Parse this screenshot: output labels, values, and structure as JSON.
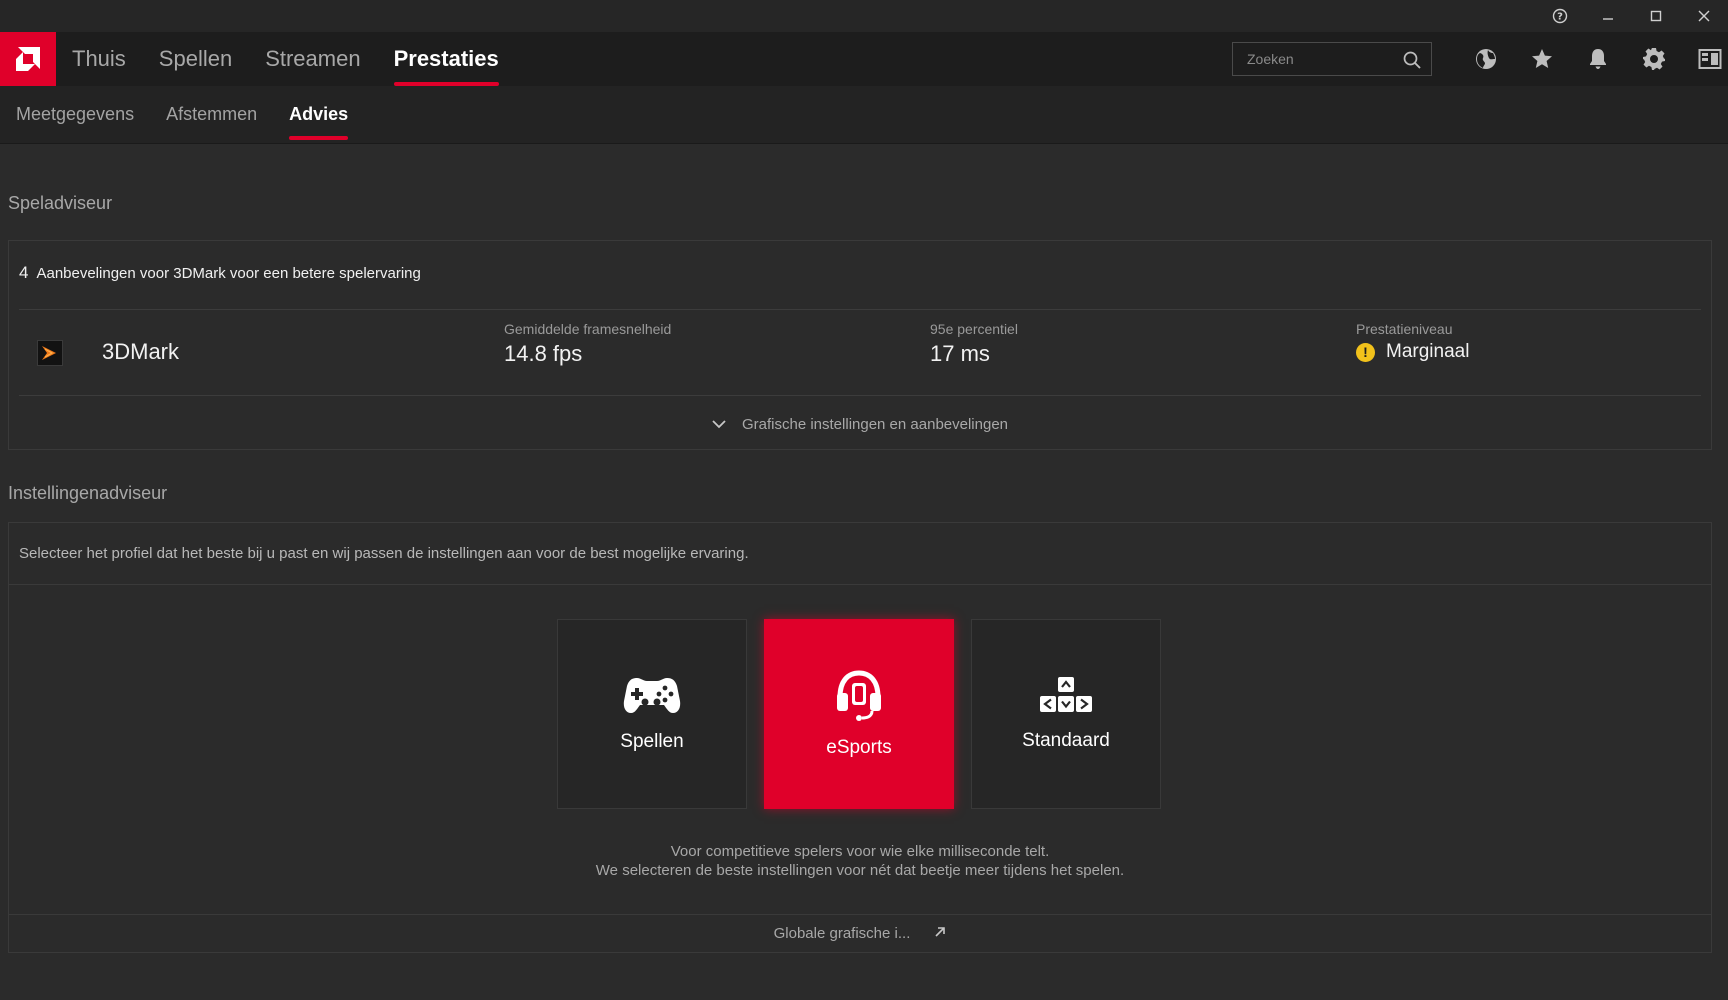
{
  "window": {
    "help_icon": "help-circle-icon",
    "minimize_icon": "minimize-icon",
    "maximize_icon": "maximize-icon",
    "close_icon": "close-icon"
  },
  "brand": {
    "logo": "amd-logo",
    "accent": "#e0002a"
  },
  "main_tabs": [
    {
      "label": "Thuis",
      "active": false
    },
    {
      "label": "Spellen",
      "active": false
    },
    {
      "label": "Streamen",
      "active": false
    },
    {
      "label": "Prestaties",
      "active": true
    }
  ],
  "search": {
    "placeholder": "Zoeken",
    "value": ""
  },
  "toolbar_icons": [
    "globe-icon",
    "star-icon",
    "bell-icon",
    "gear-icon",
    "sidebar-panel-icon"
  ],
  "sub_tabs": [
    {
      "label": "Meetgegevens",
      "active": false
    },
    {
      "label": "Afstemmen",
      "active": false
    },
    {
      "label": "Advies",
      "active": true
    }
  ],
  "game_advisor": {
    "title": "Speladviseur",
    "rec_count": "4",
    "rec_text": "Aanbevelingen voor 3DMark voor een betere spelervaring",
    "game": {
      "name": "3DMark",
      "avg_fps_label": "Gemiddelde framesnelheid",
      "avg_fps_value": "14.8 fps",
      "p95_label": "95e percentiel",
      "p95_value": "17 ms",
      "level_label": "Prestatieniveau",
      "level_value": "Marginaal",
      "level_color": "#f2c21b"
    },
    "expand_label": "Grafische instellingen en aanbevelingen"
  },
  "settings_advisor": {
    "title": "Instellingenadviseur",
    "description": "Selecteer het profiel dat het beste bij u past en wij passen de instellingen aan voor de best mogelijke ervaring.",
    "profiles": [
      {
        "label": "Spellen",
        "icon": "gamepad-icon",
        "selected": false
      },
      {
        "label": "eSports",
        "icon": "headset-icon",
        "selected": true
      },
      {
        "label": "Standaard",
        "icon": "arrow-keys-icon",
        "selected": false
      }
    ],
    "profile_desc_line1": "Voor competitieve spelers voor wie elke milliseconde telt.",
    "profile_desc_line2": "We selecteren de beste instellingen voor nét dat beetje meer tijdens het spelen.",
    "global_link": "Globale grafische i..."
  }
}
